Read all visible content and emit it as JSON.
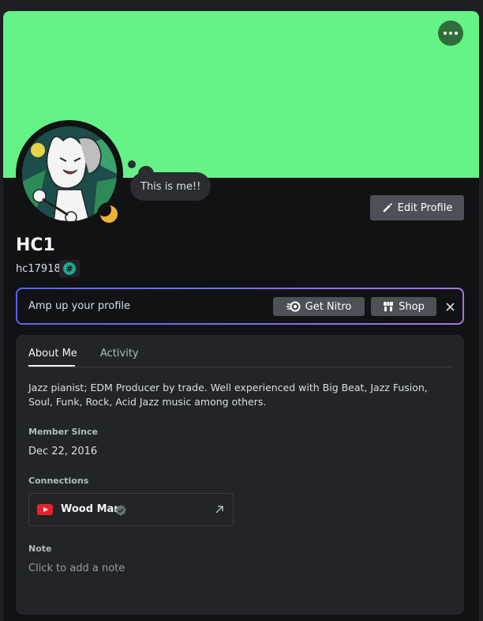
{
  "colors": {
    "banner": "#65f287",
    "more_button": "#2f6e3a",
    "avatar_status": "#f0b232",
    "nitro_gradient_start": "#5865f2",
    "nitro_gradient_end": "#a974e6",
    "youtube_red": "#e8222b",
    "username_badge": "#26a58f"
  },
  "header": {
    "more_icon": "more-horizontal-icon",
    "avatar_status": "idle-moon-icon",
    "custom_status": "This is me!!",
    "edit_profile_label": "Edit Profile",
    "edit_profile_icon": "pencil-icon"
  },
  "user": {
    "display_name": "HC1",
    "username": "hc17918",
    "badge": "#"
  },
  "nitro_bar": {
    "text": "Amp up your profile",
    "get_nitro_label": "Get Nitro",
    "shop_label": "Shop",
    "close_icon": "close-icon"
  },
  "tabs": [
    {
      "label": "About Me",
      "active": true
    },
    {
      "label": "Activity",
      "active": false
    }
  ],
  "about": {
    "bio": "Jazz pianist; EDM Producer by trade. Well experienced with Big Beat, Jazz Fusion, Soul, Funk, Rock, Acid Jazz music among others.",
    "member_since_label": "Member Since",
    "member_since_value": "Dec 22, 2016",
    "connections_label": "Connections",
    "connection": {
      "name": "Wood Man",
      "platform_icon": "youtube-icon",
      "verified_icon": "verified-check-icon",
      "link_icon": "external-link-icon"
    },
    "note_label": "Note",
    "note_placeholder": "Click to add a note"
  }
}
